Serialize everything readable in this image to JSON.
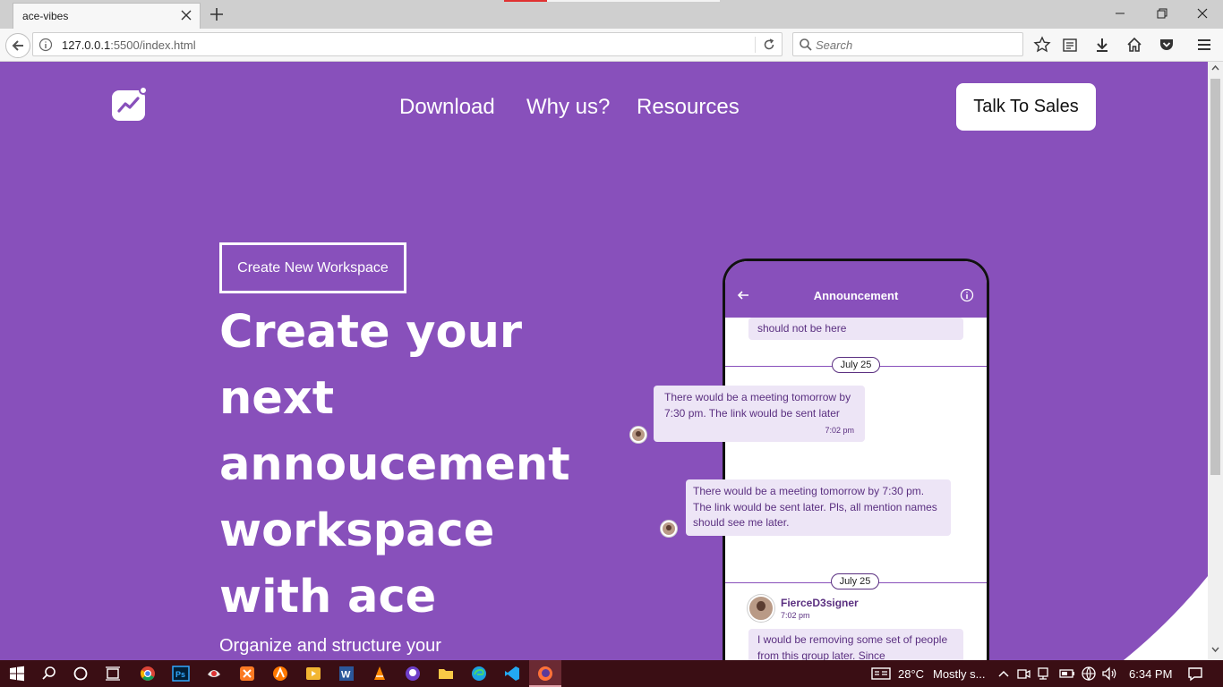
{
  "browser": {
    "tab_title": "ace-vibes",
    "url_host": "127.0.0.1",
    "url_rest": ":5500/index.html",
    "search_placeholder": "Search"
  },
  "site": {
    "nav": {
      "download": "Download",
      "why": "Why us?",
      "resources": "Resources"
    },
    "cta": "Talk To Sales",
    "create_button": "Create New Workspace",
    "hero_lines": [
      "Create your",
      "next",
      "annoucement",
      "workspace",
      "with ace"
    ],
    "hero_sub": "Organize and structure your",
    "accent": "#8850bb"
  },
  "phone": {
    "title": "Announcement",
    "msg0": "should not be here",
    "date1": "July 25",
    "msg1": "There would be a meeting tomorrow by 7:30 pm. The link would be sent later",
    "time1": "7:02 pm",
    "msg2": "There would be a meeting tomorrow by 7:30 pm. The link would be sent later. Pls, all mention names should see me later.",
    "date2": "July 25",
    "sender": "FierceD3signer",
    "sender_time": "7:02 pm",
    "msg3": "I would be removing some set of people from this group later. Since"
  },
  "taskbar": {
    "weather": "28°C",
    "weather_desc": "Mostly s...",
    "time": "6:34 PM"
  }
}
